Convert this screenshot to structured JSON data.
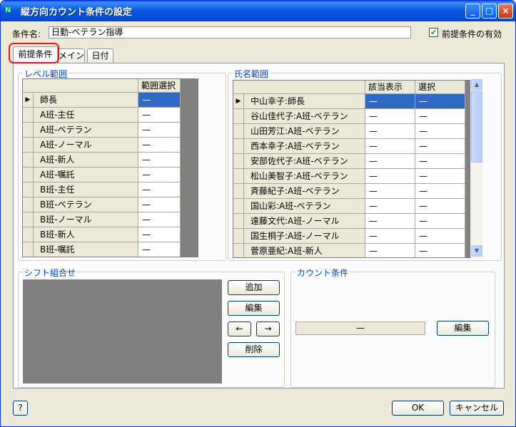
{
  "window": {
    "title": "縦方向カウント条件の設定",
    "icon_text": "N",
    "controls": {
      "minimize": "_",
      "maximize": "□",
      "close": "×"
    }
  },
  "condition": {
    "name_label": "条件名:",
    "name_value": "日勤-ベテラン指導",
    "precondition_enabled_label": "前提条件の有効",
    "precondition_enabled": true
  },
  "tabs": [
    {
      "label": "前提条件",
      "active": true
    },
    {
      "label": "メイン",
      "active": false
    },
    {
      "label": "日付",
      "active": false
    }
  ],
  "level_range": {
    "title": "レベル範囲",
    "header": "範囲選択",
    "rows": [
      {
        "name": "師長",
        "value": "—"
      },
      {
        "name": "A班-主任",
        "value": "—"
      },
      {
        "name": "A班-ベテラン",
        "value": "—"
      },
      {
        "name": "A班-ノーマル",
        "value": "—"
      },
      {
        "name": "A班-新人",
        "value": "—"
      },
      {
        "name": "A班-嘱託",
        "value": "—"
      },
      {
        "name": "B班-主任",
        "value": "—"
      },
      {
        "name": "B班-ベテラン",
        "value": "—"
      },
      {
        "name": "B班-ノーマル",
        "value": "—"
      },
      {
        "name": "B班-新人",
        "value": "—"
      },
      {
        "name": "B班-嘱託",
        "value": "—"
      }
    ]
  },
  "name_range": {
    "title": "氏名範囲",
    "headers": [
      "該当表示",
      "選択"
    ],
    "rows": [
      {
        "name": "中山幸子:師長",
        "show": "—",
        "select": "—"
      },
      {
        "name": "谷山佳代子:A班-ベテラン",
        "show": "—",
        "select": "—"
      },
      {
        "name": "山田芳江:A班-ベテラン",
        "show": "—",
        "select": "—"
      },
      {
        "name": "西本幸子:A班-ベテラン",
        "show": "—",
        "select": "—"
      },
      {
        "name": "安部佐代子:A班-ベテラン",
        "show": "—",
        "select": "—"
      },
      {
        "name": "松山美智子:A班-ベテラン",
        "show": "—",
        "select": "—"
      },
      {
        "name": "斉藤紀子:A班-ベテラン",
        "show": "—",
        "select": "—"
      },
      {
        "name": "国山彩:A班-ベテラン",
        "show": "—",
        "select": "—"
      },
      {
        "name": "遠藤文代:A班-ノーマル",
        "show": "—",
        "select": "—"
      },
      {
        "name": "国生桐子:A班-ノーマル",
        "show": "—",
        "select": "—"
      },
      {
        "name": "菅原亜紀:A班-新人",
        "show": "—",
        "select": "—"
      }
    ]
  },
  "shift_combo": {
    "title": "シフト組合せ",
    "add_label": "追加",
    "edit_label": "編集",
    "left_label": "←",
    "right_label": "→",
    "delete_label": "削除"
  },
  "count_condition": {
    "title": "カウント条件",
    "value": "—",
    "edit_label": "編集"
  },
  "footer": {
    "help_label": "?",
    "ok_label": "OK",
    "cancel_label": "キャンセル"
  }
}
